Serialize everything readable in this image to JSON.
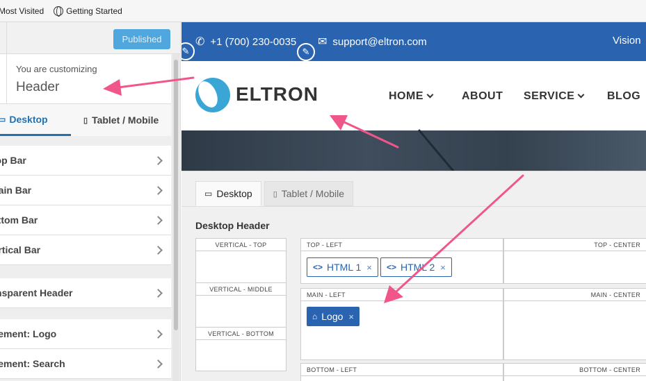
{
  "bookmarks": [
    {
      "label": "Most Visited",
      "icon": "none"
    },
    {
      "label": "Getting Started",
      "icon": "globe-icon"
    }
  ],
  "sidebar": {
    "publish_label": "Published",
    "customizing_small": "You are customizing",
    "customizing_section": "Header",
    "tabs": [
      {
        "label": "Desktop",
        "icon": "desktop-icon"
      },
      {
        "label": "Tablet / Mobile",
        "icon": "mobile-icon"
      }
    ],
    "group1": [
      "Top Bar",
      "Main Bar",
      "Bottom Bar",
      "Vertical Bar"
    ],
    "group2": [
      "Transparent Header"
    ],
    "group3": [
      "Element: Logo",
      "Element: Search"
    ]
  },
  "preview": {
    "phone": "+1 (700) 230-0035",
    "email": "support@eltron.com",
    "topbar_right": "Vision",
    "logo_text": "ELTRON",
    "nav": [
      "HOME",
      "ABOUT",
      "SERVICE",
      "BLOG"
    ]
  },
  "builder": {
    "tabs": [
      "Desktop",
      "Tablet / Mobile"
    ],
    "title": "Desktop Header",
    "vertical_labels": [
      "VERTICAL - TOP",
      "VERTICAL - MIDDLE",
      "VERTICAL - BOTTOM"
    ],
    "top_left_label": "TOP - LEFT",
    "top_center_label": "TOP - CENTER",
    "main_left_label": "MAIN - LEFT",
    "main_center_label": "MAIN - CENTER",
    "bottom_left_label": "BOTTOM - LEFT",
    "bottom_center_label": "BOTTOM - CENTER",
    "chip_html1": "HTML 1",
    "chip_html2": "HTML 2",
    "chip_logo": "Logo",
    "remove_glyph": "×"
  },
  "colors": {
    "accent": "#2a63b0",
    "publish": "#4fa7dd",
    "arrow": "#f0568a"
  }
}
